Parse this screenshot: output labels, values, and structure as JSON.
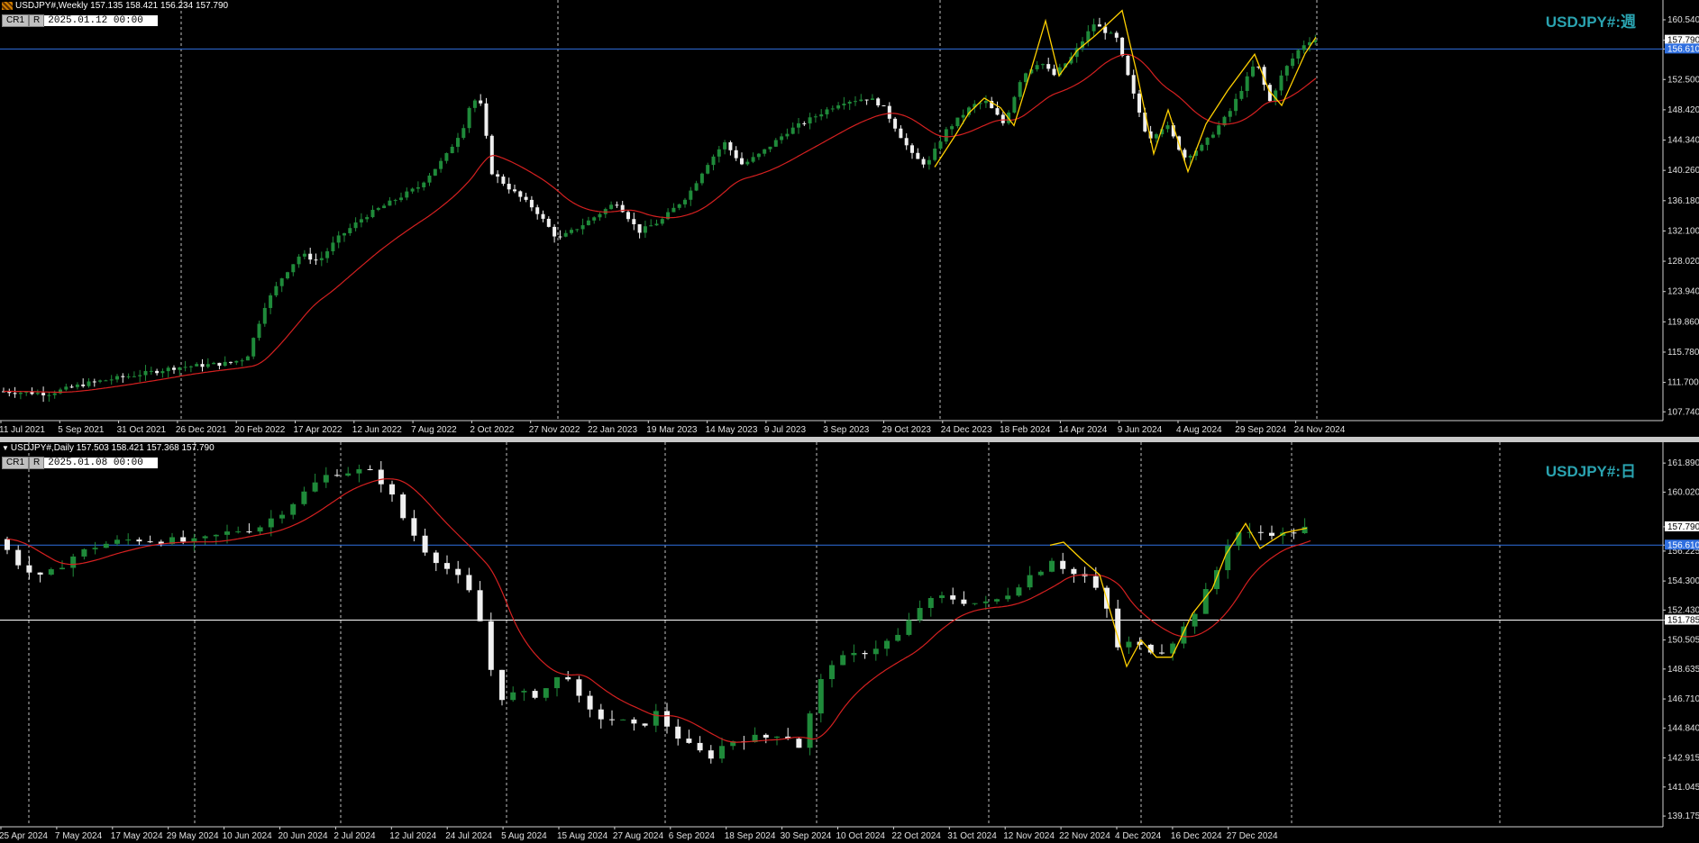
{
  "top": {
    "header": "USDJPY#,Weekly  157.135 158.421 156.234 157.790",
    "buttons": [
      "CR1",
      "R"
    ],
    "date_value": "2025.01.12 00:00",
    "title": "USDJPY#:週",
    "price_labels": [
      "160.540",
      "157.790",
      "156.610",
      "152.500",
      "148.420",
      "144.340",
      "140.260",
      "136.180",
      "132.100",
      "128.020",
      "123.940",
      "119.860",
      "115.780",
      "111.700",
      "107.740"
    ],
    "date_labels": [
      "11 Jul 2021",
      "5 Sep 2021",
      "31 Oct 2021",
      "26 Dec 2021",
      "20 Feb 2022",
      "17 Apr 2022",
      "12 Jun 2022",
      "7 Aug 2022",
      "2 Oct 2022",
      "27 Nov 2022",
      "22 Jan 2023",
      "19 Mar 2023",
      "14 May 2023",
      "9 Jul 2023",
      "3 Sep 2023",
      "29 Oct 2023",
      "24 Dec 2023",
      "18 Feb 2024",
      "14 Apr 2024",
      "9 Jun 2024",
      "4 Aug 2024",
      "29 Sep 2024",
      "24 Nov 2024"
    ],
    "y_range": [
      106.8,
      162.6
    ],
    "current_price": 157.79,
    "hline_price": 156.61
  },
  "bottom": {
    "header": "USDJPY#,Daily  157.503 158.421 157.368 157.790",
    "buttons": [
      "CR1",
      "R"
    ],
    "date_value": "2025.01.08 00:00",
    "title": "USDJPY#:日",
    "price_labels": [
      "161.890",
      "160.020",
      "157.790",
      "156.610",
      "156.225",
      "154.300",
      "152.430",
      "151.785",
      "150.505",
      "148.635",
      "146.710",
      "144.840",
      "142.915",
      "141.045",
      "139.175"
    ],
    "date_labels": [
      "25 Apr 2024",
      "7 May 2024",
      "17 May 2024",
      "29 May 2024",
      "10 Jun 2024",
      "20 Jun 2024",
      "2 Jul 2024",
      "12 Jul 2024",
      "24 Jul 2024",
      "5 Aug 2024",
      "15 Aug 2024",
      "27 Aug 2024",
      "6 Sep 2024",
      "18 Sep 2024",
      "30 Sep 2024",
      "10 Oct 2024",
      "22 Oct 2024",
      "31 Oct 2024",
      "12 Nov 2024",
      "22 Nov 2024",
      "4 Dec 2024",
      "16 Dec 2024",
      "27 Dec 2024"
    ],
    "y_range": [
      138.6,
      163.0
    ],
    "current_price": 157.79,
    "hline_price": 156.61,
    "hline2_price": 151.785
  },
  "colors": {
    "background": "#000000",
    "bull_candle": "#1f8a3a",
    "bear_candle": "#f0f0f0",
    "ma_line": "#d42020",
    "zigzag": "#ffd000",
    "hline": "#2f6fe0",
    "title": "#2aa3b0",
    "grid_vline": "#c0c0c0"
  }
}
